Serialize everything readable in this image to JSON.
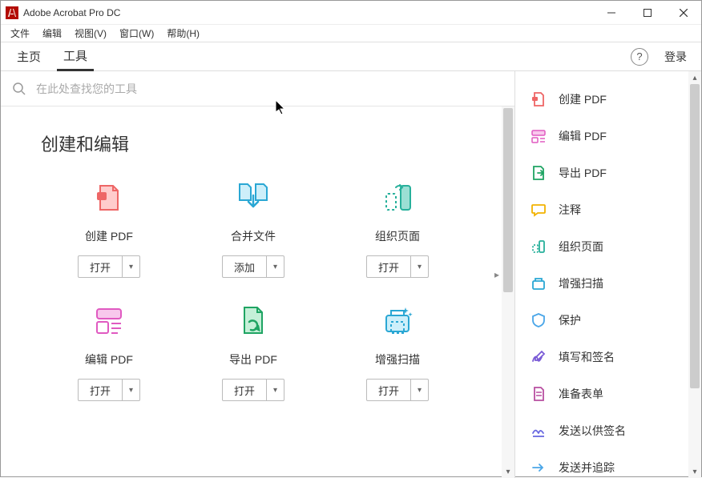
{
  "app_title": "Adobe Acrobat Pro DC",
  "menubar": [
    "文件",
    "编辑",
    "视图(V)",
    "窗口(W)",
    "帮助(H)"
  ],
  "tabs": {
    "home": "主页",
    "tools": "工具"
  },
  "login_label": "登录",
  "search_placeholder": "在此处查找您的工具",
  "section_title": "创建和编辑",
  "tool_cards": [
    {
      "name": "创建 PDF",
      "action": "打开"
    },
    {
      "name": "合并文件",
      "action": "添加"
    },
    {
      "name": "组织页面",
      "action": "打开"
    },
    {
      "name": "编辑 PDF",
      "action": "打开"
    },
    {
      "name": "导出 PDF",
      "action": "打开"
    },
    {
      "name": "增强扫描",
      "action": "打开"
    }
  ],
  "sidebar_items": [
    {
      "label": "创建 PDF"
    },
    {
      "label": "编辑 PDF"
    },
    {
      "label": "导出 PDF"
    },
    {
      "label": "注释"
    },
    {
      "label": "组织页面"
    },
    {
      "label": "增强扫描"
    },
    {
      "label": "保护"
    },
    {
      "label": "填写和签名"
    },
    {
      "label": "准备表单"
    },
    {
      "label": "发送以供签名"
    },
    {
      "label": "发送并追踪"
    }
  ]
}
